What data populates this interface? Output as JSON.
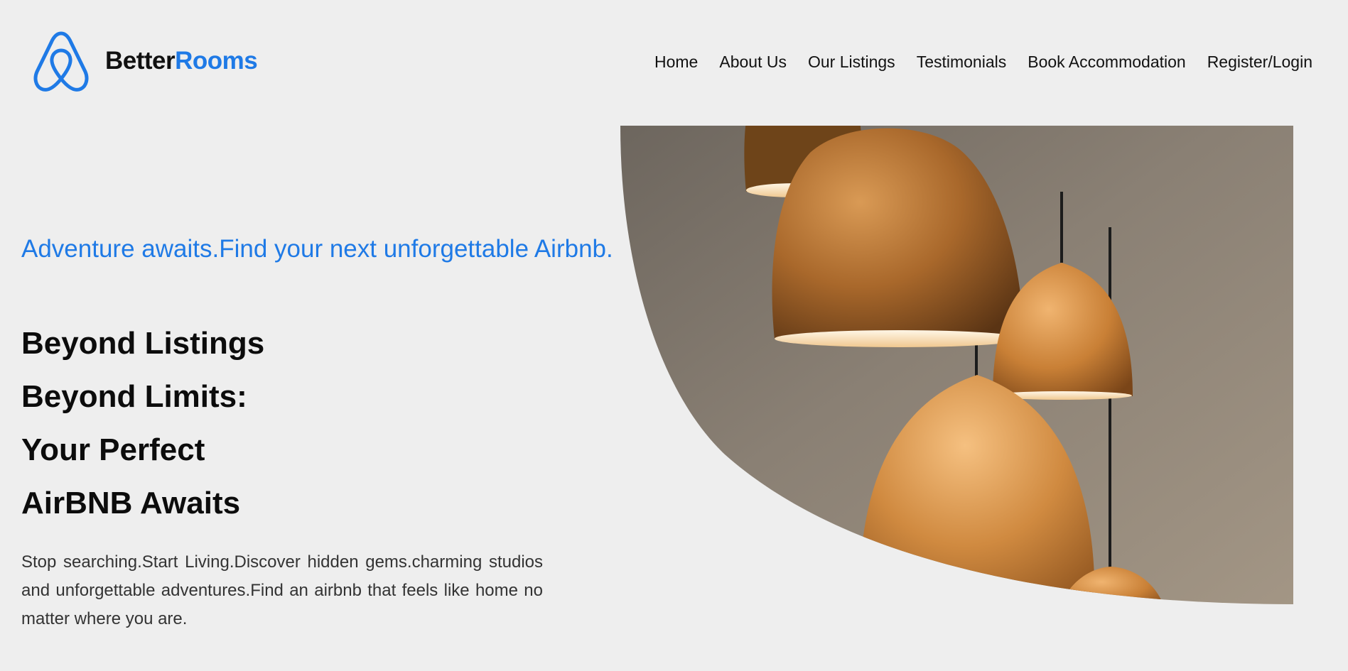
{
  "header": {
    "brand_part1": "Better",
    "brand_part2": "Rooms",
    "logo_icon": "airbnb-style-loop-icon"
  },
  "nav": {
    "items": [
      {
        "label": "Home"
      },
      {
        "label": "About Us"
      },
      {
        "label": "Our Listings"
      },
      {
        "label": "Testimonials"
      },
      {
        "label": "Book Accommodation"
      },
      {
        "label": "Register/Login"
      }
    ]
  },
  "hero": {
    "tagline": "Adventure awaits.Find your next unforgettable Airbnb.",
    "headline_lines": [
      "Beyond Listings",
      "Beyond Limits:",
      "Your Perfect",
      "AirBNB Awaits"
    ],
    "description": "Stop searching.Start Living.Discover hidden gems.charming studios and unforgettable adventures.Find an airbnb that feels like home no matter where you are.",
    "image_subject": "copper pendant lamps"
  },
  "colors": {
    "accent": "#1f7ae6",
    "background": "#eeeeee",
    "copper": "#c9843e"
  }
}
